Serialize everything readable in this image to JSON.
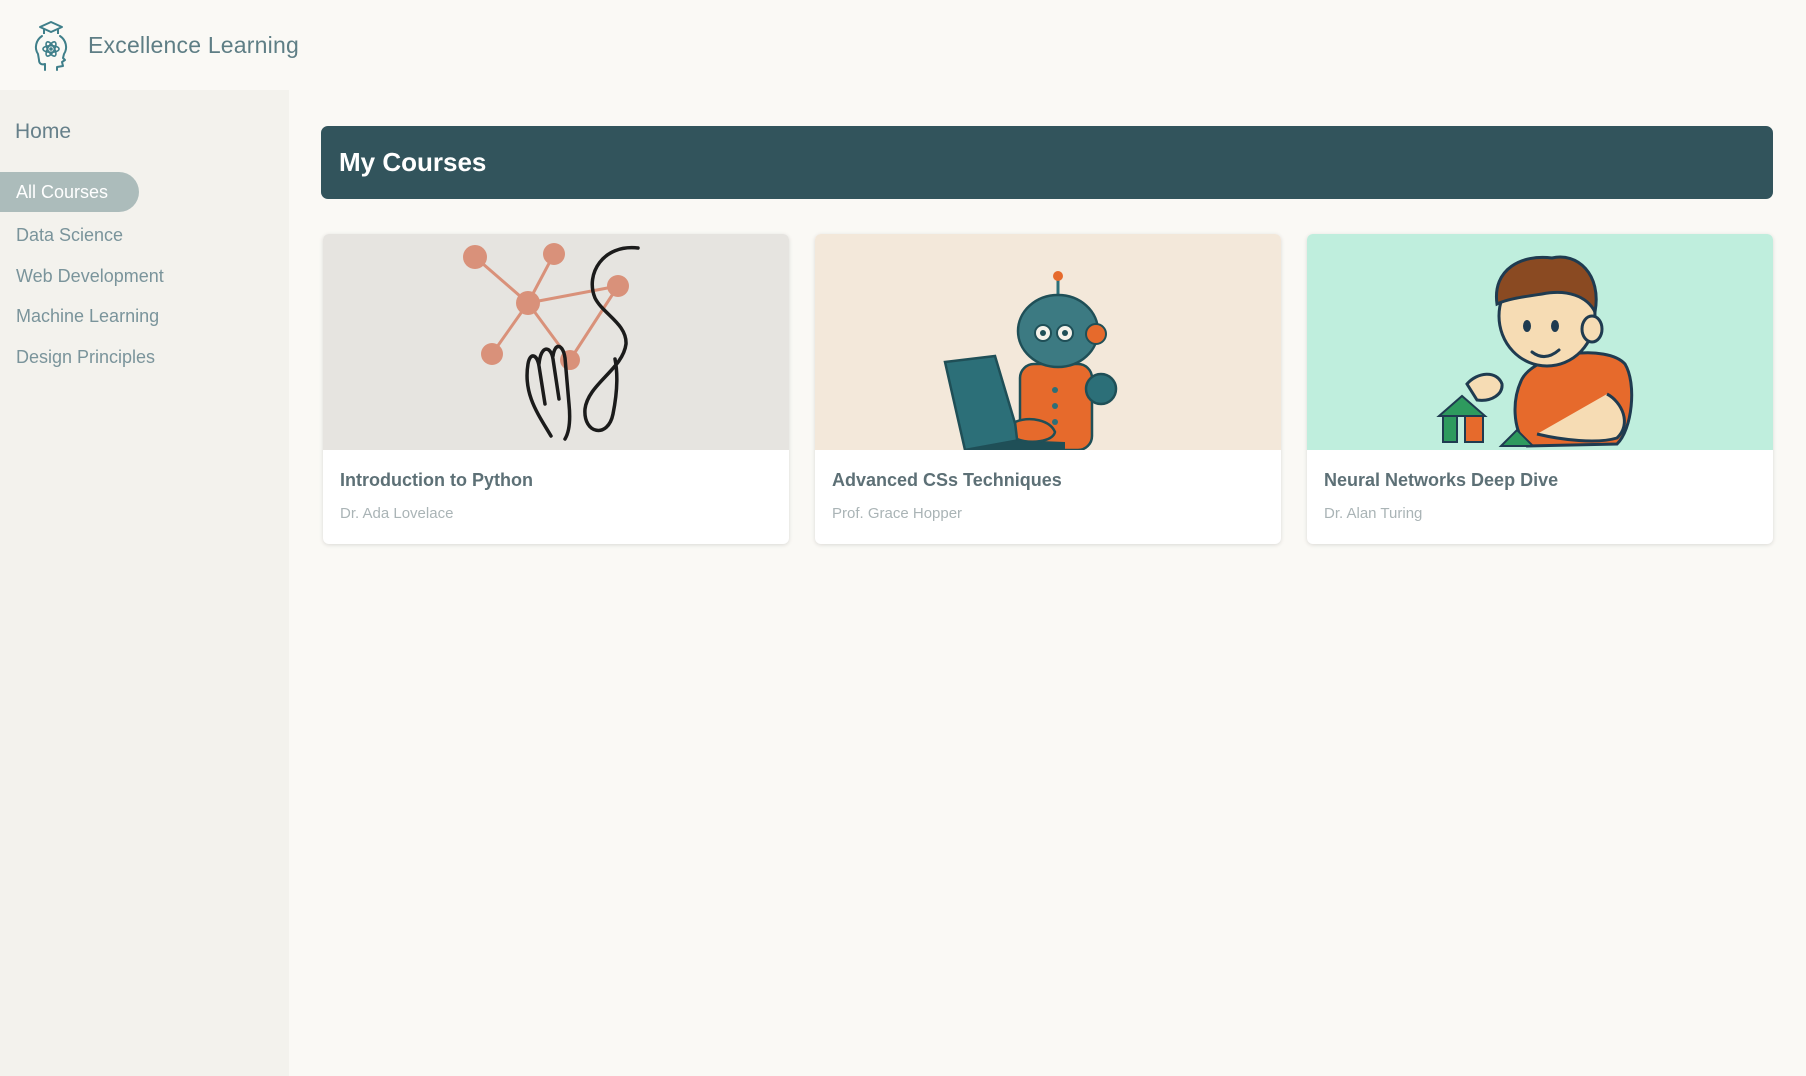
{
  "app": {
    "brand_name": "Excellence Learning"
  },
  "sidebar": {
    "home_label": "Home",
    "items": [
      {
        "label": "All Courses",
        "active": true
      },
      {
        "label": "Data Science",
        "active": false
      },
      {
        "label": "Web Development",
        "active": false
      },
      {
        "label": "Machine Learning",
        "active": false
      },
      {
        "label": "Design Principles",
        "active": false
      }
    ]
  },
  "main": {
    "title": "My Courses",
    "courses": [
      {
        "title": "Introduction to Python",
        "instructor": "Dr. Ada Lovelace",
        "image_icon": "network-hand-illustration-icon",
        "image_bg": "#e6e4e0"
      },
      {
        "title": "Advanced CSs Techniques",
        "instructor": "Prof. Grace Hopper",
        "image_icon": "robot-laptop-illustration-icon",
        "image_bg": "#f3e8da"
      },
      {
        "title": "Neural Networks Deep Dive",
        "instructor": "Dr. Alan Turing",
        "image_icon": "boy-building-blocks-illustration-icon",
        "image_bg": "#bfeedd"
      }
    ]
  },
  "colors": {
    "page_bg": "#faf9f5",
    "sidebar_bg": "#f3f2ed",
    "header_bg": "#32545c",
    "active_nav_bg": "#acbcbb",
    "brand_text": "#5e7e85"
  }
}
